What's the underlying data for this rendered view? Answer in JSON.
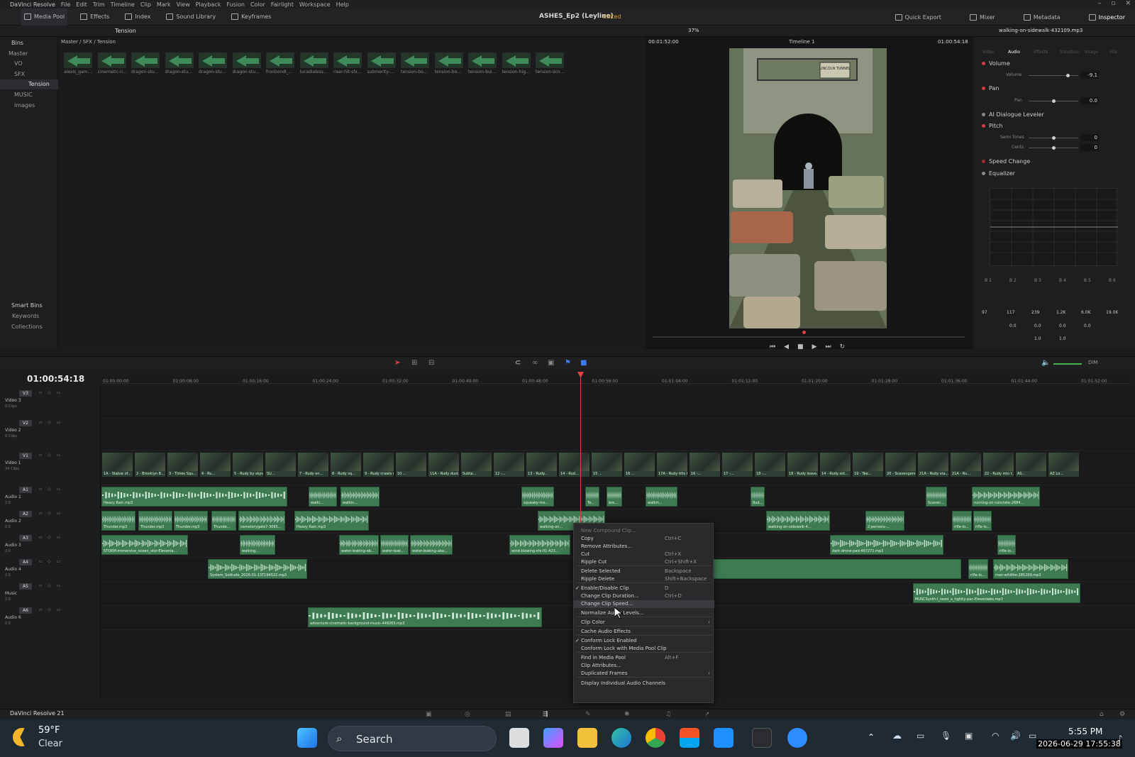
{
  "app": {
    "name": "DaVinci Resolve",
    "menu": [
      "File",
      "Edit",
      "Trim",
      "Timeline",
      "Clip",
      "Mark",
      "View",
      "Playback",
      "Fusion",
      "Color",
      "Fairlight",
      "Workspace",
      "Help"
    ],
    "project_title": "ASHES_Ep2 (Leyline)",
    "project_state": "Edited",
    "toolbar_left": [
      "Media Pool",
      "Effects",
      "Index",
      "Sound Library",
      "Keyframes"
    ],
    "toolbar_right": [
      "Quick Export",
      "Mixer",
      "Metadata",
      "Inspector"
    ],
    "zoom": "37%"
  },
  "bins": {
    "header": "Bins",
    "current_bin": "Tension",
    "items": [
      "Master",
      "VO",
      "SFX",
      "Tension",
      "MUSIC",
      "Images"
    ],
    "smart_header": "Smart Bins",
    "smart_items": [
      "Keywords",
      "Collections"
    ]
  },
  "media_pool": {
    "breadcrumb": "Master / SFX / Tension",
    "clips": [
      "alexis_gam...",
      "cinematic-ri...",
      "dragon-stu...",
      "dragon-stu...",
      "dragon-stu...",
      "dragon-stu...",
      "fronbondi_...",
      "lucadialess...",
      "riser-hit-sfx...",
      "submerity-...",
      "tension-bo...",
      "tension-bo...",
      "tension-bui...",
      "tension-hig...",
      "tension-scn..."
    ]
  },
  "viewer": {
    "timecode_left": "00:01:52:00",
    "timeline_name": "Timeline 1",
    "timecode_right": "01:00:54:18",
    "sign_text": "LINCOLN TUNNEL"
  },
  "inspector": {
    "clip_name": "walking-on-sidewalk-432109.mp3",
    "tabs": [
      "Video",
      "Audio",
      "Effects",
      "Transition",
      "Image",
      "File"
    ],
    "active_tab": "Audio",
    "volume": {
      "title": "Volume",
      "label": "Volume",
      "value": "-9.1",
      "level": 0.78
    },
    "pan": {
      "title": "Pan",
      "label": "Pan",
      "value": "0.0",
      "level": 0.5
    },
    "ai_leveler": "AI Dialogue Leveler",
    "pitch": {
      "title": "Pitch",
      "semitones_label": "Semi Tones",
      "semitones": "0",
      "cents_label": "Cents",
      "cents": "0"
    },
    "speed_change": "Speed Change",
    "equalizer": "Equalizer",
    "bands": [
      "B 1",
      "B 2",
      "B 3",
      "B 4",
      "B 5",
      "B 6"
    ],
    "freq": [
      "97",
      "117",
      "239",
      "1.2K",
      "6.0K",
      "19.0K"
    ],
    "gain": [
      "",
      "0.0",
      "0.0",
      "0.0",
      "0.0",
      ""
    ],
    "q": [
      "",
      "",
      "1.0",
      "1.0",
      "",
      ""
    ]
  },
  "timeline": {
    "timecode": "01:00:54:18",
    "ruler": [
      "01:00:00:00",
      "01:00:08:00",
      "01:00:16:00",
      "01:00:24:00",
      "01:00:32:00",
      "01:00:40:00",
      "01:00:48:00",
      "01:00:56:00",
      "01:01:04:00",
      "01:01:12:00",
      "01:01:20:00",
      "01:01:28:00",
      "01:01:36:00",
      "01:01:44:00",
      "01:01:52:00"
    ],
    "tracks": [
      {
        "id": "V3",
        "name": "Video 3",
        "sub": "0 Clips"
      },
      {
        "id": "V2",
        "name": "Video 2",
        "sub": "0 Clips"
      },
      {
        "id": "V1",
        "name": "Video 1",
        "sub": "34 Clips"
      },
      {
        "id": "A1",
        "name": "Audio 1",
        "sub": "2.0"
      },
      {
        "id": "A2",
        "name": "Audio 2",
        "sub": "2.0"
      },
      {
        "id": "A3",
        "name": "Audio 3",
        "sub": "2.0"
      },
      {
        "id": "A4",
        "name": "Audio 4",
        "sub": "2.0"
      },
      {
        "id": "A5",
        "name": "Music",
        "sub": "2.0"
      },
      {
        "id": "A6",
        "name": "Audio 6",
        "sub": "2.0"
      }
    ],
    "video_clips": [
      "1A - Statue of...",
      "2 - Brooklyn B...",
      "3 - Times Squ...",
      "4 - Ru...",
      "5 - Rudy by skys...",
      "SU...",
      "7 - Rudy en...",
      "8 - Rudy sq...",
      "9 - Rudy crawls under ...",
      "10 ...",
      "11A - Rudy dust...",
      "Subta...",
      "12 -...",
      "13 - Rudy...",
      "14 - Rud...",
      "15 ...",
      "16 ...",
      "17A - Rudy tilts h...",
      "16 -...",
      "17 -...",
      "18 -...",
      "18 - Rudy leave...",
      "14 - Rudy sid...",
      "19 - Tee...",
      "20 - Scavengers appr...",
      "21A - Rudy sta...",
      "21A - Ru...",
      "22 - Rudy into t...",
      "AS...",
      "AZ Lo..."
    ],
    "audio_clips": {
      "a1": [
        "Heavy Rain.mp3",
        "walki...",
        "walkin...",
        "squeaky-me...",
        "Te...",
        "bre...",
        "walkin...",
        "Rud...",
        "Scaven...",
        "running-on-concrete-2684..."
      ],
      "a2": [
        "Thunder.mp3",
        "Thunder.mp3",
        "Thunder.mp3",
        "Thunde...",
        "cemeterygate7-3065...",
        "Heavy Rain.mp3",
        "walking-on...",
        "walking-on-sidewalk-4...",
        "2-persons-...",
        "rifle-lo...",
        "rifle-lo..."
      ],
      "a3": [
        "STORM-immersive_ocean_stor-Elevenla...",
        "walking...",
        "water-leaking-ab...",
        "water-leak...",
        "water-leaking-aba...",
        "wind-blowing-sfx-01-423...",
        "dark-drone-pad-467271.mp3",
        "rifle-lo..."
      ],
      "a4": [
        "System_Solitude_2026-01-13T194522.mp3",
        "rifle-lo...",
        "riser-wildfire-285209.mp3"
      ],
      "a5": [
        "MUSCSynth-I_need_a_tightly-pac-Elevenlabs.mp3"
      ],
      "a6": [
        "adventure-cinematic-background-music-449265.mp3"
      ]
    }
  },
  "context_menu": {
    "items": [
      {
        "label": "New Compound Clip...",
        "shortcut": "",
        "disabled": true
      },
      {
        "label": "Copy",
        "shortcut": "Ctrl+C"
      },
      {
        "label": "Remove Attributes...",
        "shortcut": ""
      },
      {
        "label": "Cut",
        "shortcut": "Ctrl+X"
      },
      {
        "label": "Ripple Cut",
        "shortcut": "Ctrl+Shift+X"
      },
      {
        "label": "Delete Selected",
        "shortcut": "Backspace"
      },
      {
        "label": "Ripple Delete",
        "shortcut": "Shift+Backspace"
      },
      {
        "label": "Enable/Disable Clip",
        "shortcut": "D",
        "check": true
      },
      {
        "label": "Change Clip Duration...",
        "shortcut": "Ctrl+D"
      },
      {
        "label": "Change Clip Speed...",
        "shortcut": "",
        "highlight": true
      },
      {
        "label": "Normalize Audio Levels...",
        "shortcut": ""
      },
      {
        "label": "Clip Color",
        "shortcut": "",
        "submenu": true
      },
      {
        "label": "Cache Audio Effects",
        "shortcut": ""
      },
      {
        "label": "Conform Lock Enabled",
        "shortcut": "",
        "check": true
      },
      {
        "label": "Conform Lock with Media Pool Clip",
        "shortcut": ""
      },
      {
        "label": "Find in Media Pool",
        "shortcut": "Alt+F"
      },
      {
        "label": "Clip Attributes...",
        "shortcut": ""
      },
      {
        "label": "Duplicated Frames",
        "shortcut": "",
        "submenu": true
      },
      {
        "label": "Display Individual Audio Channels",
        "shortcut": ""
      }
    ]
  },
  "footer": {
    "brand": "DaVinci Resolve 21"
  },
  "taskbar": {
    "weather_temp": "59°F",
    "weather_desc": "Clear",
    "search_placeholder": "Search",
    "time": "5:55 PM",
    "date": "2026-06-29 17:55:38"
  }
}
